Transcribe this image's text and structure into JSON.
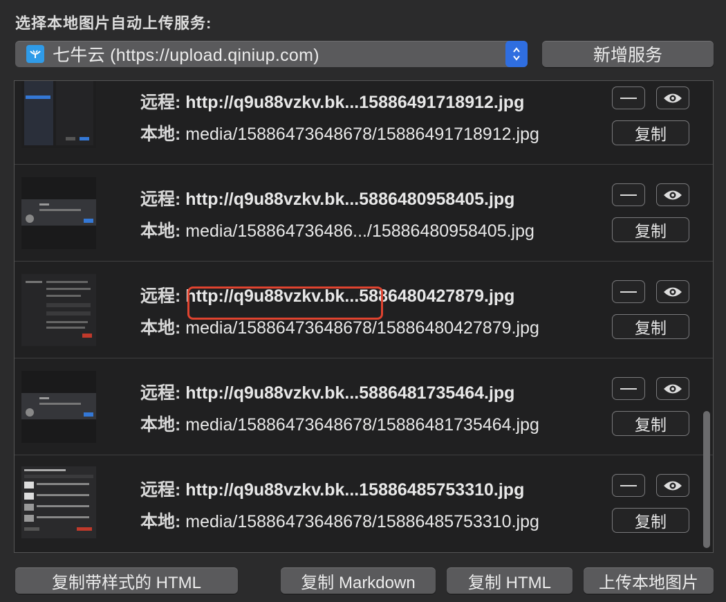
{
  "header": {
    "title": "选择本地图片自动上传服务:"
  },
  "service": {
    "icon": "qiniu-logo-icon",
    "label": "七牛云 (https://upload.qiniup.com)",
    "add_label": "新增服务"
  },
  "colors": {
    "accent": "#2f6ee0",
    "highlight": "#e0432f",
    "background": "#2b2b2c"
  },
  "rows": [
    {
      "remote_prefix": "远程:",
      "remote": "http://q9u88vzkv.bk...15886491718912.jpg",
      "local_prefix": "本地:",
      "local": "media/15886473648678/15886491718912.jpg",
      "copy_label": "复制",
      "remove_icon": "minus-icon",
      "preview_icon": "eye-icon"
    },
    {
      "remote_prefix": "远程:",
      "remote": "http://q9u88vzkv.bk...5886480958405.jpg",
      "local_prefix": "本地:",
      "local": "media/158864736486.../15886480958405.jpg",
      "copy_label": "复制",
      "remove_icon": "minus-icon",
      "preview_icon": "eye-icon"
    },
    {
      "remote_prefix": "远程:",
      "remote_highlighted": "http://q9u88vzkv.bk",
      "remote_rest": "...5886480427879.jpg",
      "local_prefix": "本地:",
      "local": "media/15886473648678/15886480427879.jpg",
      "copy_label": "复制",
      "remove_icon": "minus-icon",
      "preview_icon": "eye-icon"
    },
    {
      "remote_prefix": "远程:",
      "remote": "http://q9u88vzkv.bk...5886481735464.jpg",
      "local_prefix": "本地:",
      "local": "media/15886473648678/15886481735464.jpg",
      "copy_label": "复制",
      "remove_icon": "minus-icon",
      "preview_icon": "eye-icon"
    },
    {
      "remote_prefix": "远程:",
      "remote": "http://q9u88vzkv.bk...15886485753310.jpg",
      "local_prefix": "本地:",
      "local": "media/15886473648678/15886485753310.jpg",
      "copy_label": "复制",
      "remove_icon": "minus-icon",
      "preview_icon": "eye-icon"
    }
  ],
  "footer": {
    "copy_styled_html": "复制带样式的 HTML",
    "copy_markdown": "复制 Markdown",
    "copy_html": "复制 HTML",
    "upload_local": "上传本地图片"
  }
}
